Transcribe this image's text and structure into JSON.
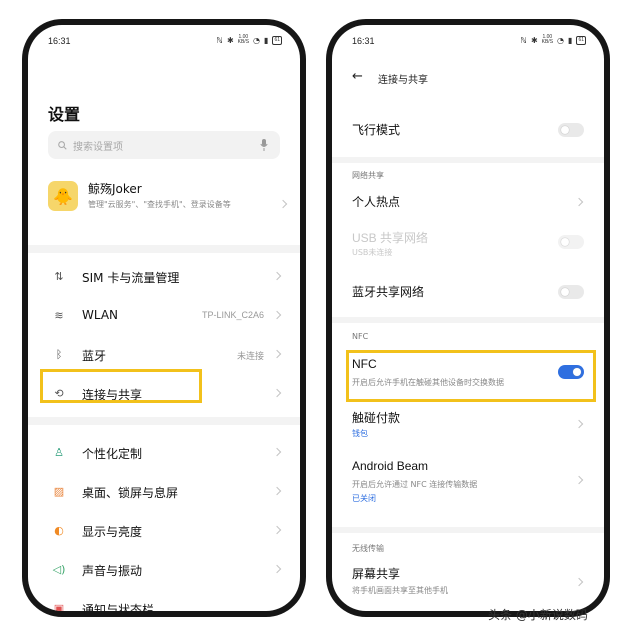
{
  "left": {
    "status": {
      "time": "16:31",
      "speed_top": "1.00",
      "speed_bottom": "KB/S",
      "battery": "61"
    },
    "title": "设置",
    "search": {
      "placeholder": "搜索设置项"
    },
    "account": {
      "name": "鲸殇Joker",
      "desc": "管理\"云服务\"、\"查找手机\"、登录设备等"
    },
    "items": [
      {
        "label": "SIM 卡与流量管理",
        "icon": "sim-icon",
        "value": ""
      },
      {
        "label": "WLAN",
        "icon": "wifi-icon",
        "value": "TP-LINK_C2A6"
      },
      {
        "label": "蓝牙",
        "icon": "bluetooth-icon",
        "value": "未连接"
      },
      {
        "label": "连接与共享",
        "icon": "connection-share-icon",
        "value": "",
        "highlighted": true
      },
      {
        "label": "个性化定制",
        "icon": "personalization-icon",
        "value": ""
      },
      {
        "label": "桌面、锁屏与息屏",
        "icon": "home-screen-icon",
        "value": ""
      },
      {
        "label": "显示与亮度",
        "icon": "display-icon",
        "value": ""
      },
      {
        "label": "声音与振动",
        "icon": "sound-icon",
        "value": ""
      },
      {
        "label": "通知与状态栏",
        "icon": "notification-icon",
        "value": ""
      }
    ]
  },
  "right": {
    "status": {
      "time": "16:31",
      "speed_top": "1.00",
      "speed_bottom": "KB/S",
      "battery": "61"
    },
    "header_title": "连接与共享",
    "airplane": {
      "label": "飞行模式",
      "on": false
    },
    "network_share_title": "网络共享",
    "hotspot": {
      "label": "个人热点"
    },
    "usb_share": {
      "label": "USB 共享网络",
      "sub": "USB未连接",
      "disabled": true
    },
    "bt_share": {
      "label": "蓝牙共享网络",
      "on": false
    },
    "nfc_section_title": "NFC",
    "nfc": {
      "label": "NFC",
      "sub": "开启后允许手机在触碰其他设备时交换数据",
      "on": true
    },
    "tap_pay": {
      "label": "触碰付款",
      "link": "钱包"
    },
    "android_beam": {
      "label": "Android Beam",
      "sub": "开启后允许通过 NFC 连接传输数据",
      "link": "已关闭"
    },
    "wireless_title": "无线传输",
    "screen_share": {
      "label": "屏幕共享",
      "sub": "将手机画面共享至其他手机"
    }
  },
  "watermark": "头条 @小新说数码",
  "colors": {
    "accent": "#2f6fe0",
    "highlight": "#f2c11b"
  }
}
